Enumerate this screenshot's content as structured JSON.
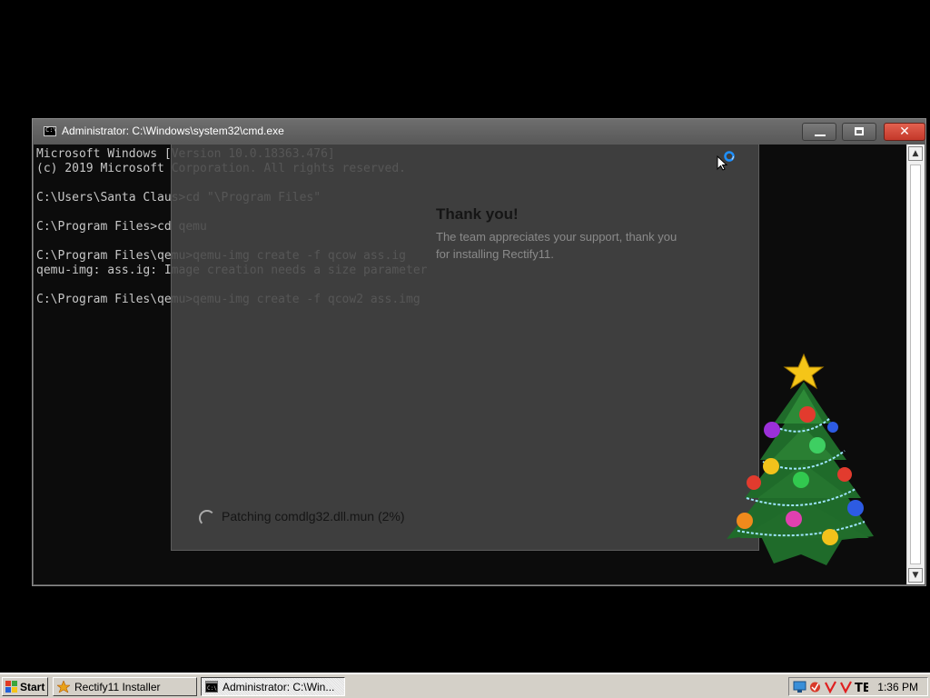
{
  "cmd_window": {
    "title": "Administrator: C:\\Windows\\system32\\cmd.exe",
    "lines": [
      "Microsoft Windows [Version 10.0.18363.476]",
      "(c) 2019 Microsoft Corporation. All rights reserved.",
      "",
      "C:\\Users\\Santa Claus>cd \"\\Program Files\"",
      "",
      "C:\\Program Files>cd qemu",
      "",
      "C:\\Program Files\\qemu>qemu-img create -f qcow ass.ig",
      "qemu-img: ass.ig: Image creation needs a size parameter",
      "",
      "C:\\Program Files\\qemu>qemu-img create -f qcow2 ass.img"
    ],
    "close_glyph": "✕"
  },
  "installer": {
    "heading": "Thank you!",
    "message": "The team appreciates your support, thank you for installing Rectify11.",
    "status": "Patching comdlg32.dll.mun (2%)",
    "progress_percent": 2
  },
  "taskbar": {
    "start_label": "Start",
    "tasks": [
      {
        "label": "Rectify11 Installer",
        "icon": "rectify-icon",
        "active": false
      },
      {
        "label": "Administrator: C:\\Win...",
        "icon": "cmd-icon",
        "active": true
      }
    ],
    "tray_icons": [
      "network-icon",
      "shield-icon",
      "check-red-icon",
      "check-red-icon",
      "app-tb-icon"
    ],
    "clock": "1:36 PM"
  },
  "colors": {
    "console_bg": "#0c0c0c",
    "console_text": "#c8c8c8",
    "close_button": "#c4382a",
    "taskbar": "#d4d0c8"
  }
}
